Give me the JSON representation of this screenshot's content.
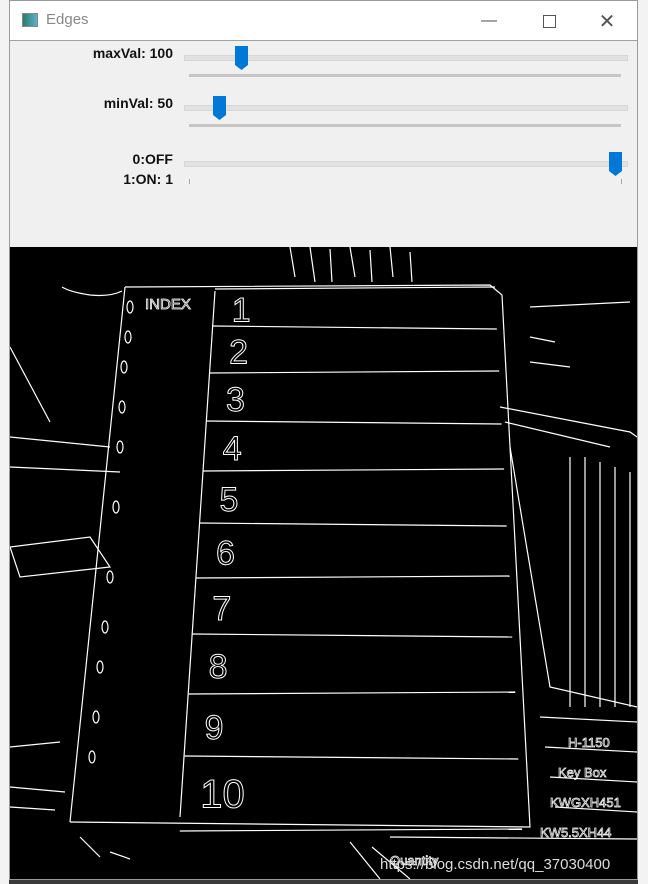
{
  "window": {
    "title": "Edges",
    "minimize_icon": "minimize-icon",
    "maximize_icon": "maximize-icon",
    "close_icon": "close-icon"
  },
  "trackbars": [
    {
      "label": "maxVal: 100",
      "value": 100,
      "max": 1000,
      "color": "#0078d7"
    },
    {
      "label": "minVal: 50",
      "value": 50,
      "max": 1000,
      "color": "#0078d7"
    },
    {
      "label_line1": "0:OFF",
      "label_line2": "1:ON: 1",
      "value": 1,
      "max": 1
    }
  ],
  "image": {
    "index_label": "INDEX",
    "tabs": [
      "1",
      "2",
      "3",
      "4",
      "5",
      "6",
      "7",
      "8",
      "9",
      "10"
    ],
    "side_texts": [
      "H-1150",
      "Key Box",
      "KWGXH451",
      "KW5.5XH44",
      "Quantity"
    ],
    "watermark": "https://blog.csdn.net/qq_37030400"
  }
}
